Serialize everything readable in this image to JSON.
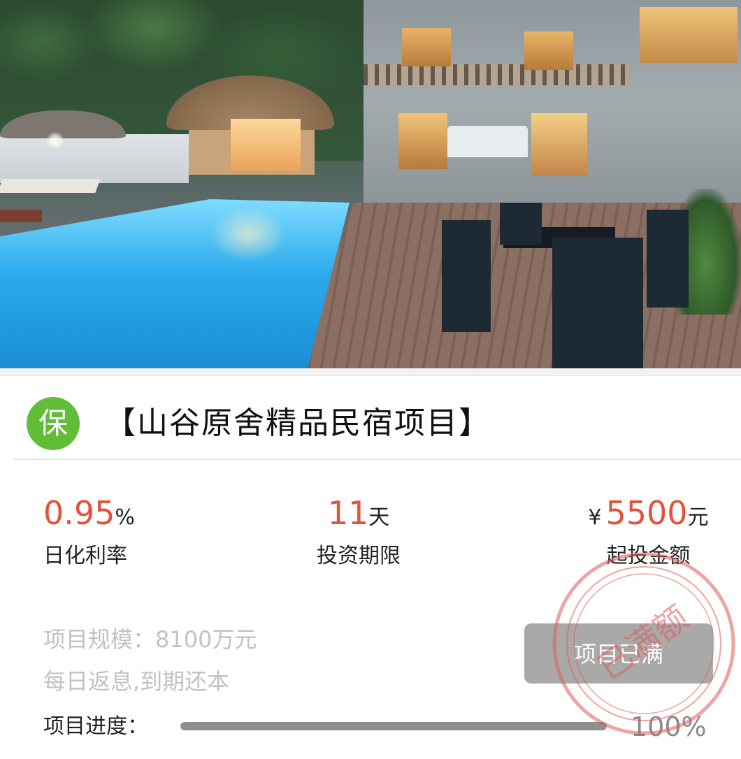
{
  "project": {
    "badge": "保",
    "title": "【山谷原舍精品民宿项目】",
    "scale_text": "项目规模：8100万元",
    "repay_text": "每日返息,到期还本",
    "status_button": "项目已满",
    "stamp_text": "已满额"
  },
  "stats": {
    "rate": {
      "value": "0.95",
      "unit": "%",
      "label": "日化利率"
    },
    "term": {
      "value": "11",
      "unit": "天",
      "label": "投资期限"
    },
    "min_amount": {
      "prefix": "¥",
      "value": "5500",
      "unit": "元",
      "label": "起投金额"
    }
  },
  "progress": {
    "label": "项目进度：",
    "percent_text": "100%",
    "fraction": 1.0
  },
  "colors": {
    "accent_red": "#e0533e",
    "badge_green": "#5fbe36",
    "stamp_red": "#e05a5a",
    "button_gray": "#a9a9a9"
  }
}
